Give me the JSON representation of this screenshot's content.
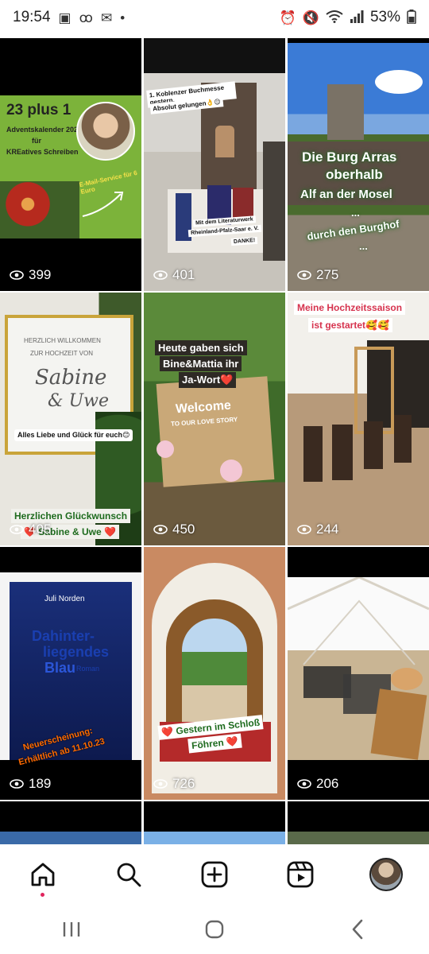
{
  "status_bar": {
    "time": "19:54",
    "battery": "53%",
    "dot": "•"
  },
  "posts": [
    {
      "views": "399",
      "texts": {
        "title": "23 plus 1",
        "sub1": "Adventskalender 2024",
        "sub2": "für",
        "sub3": "KREatives Schreiben",
        "email": "E-Mail-Service für 6 Euro"
      }
    },
    {
      "views": "401",
      "texts": {
        "caption1": "1. Koblenzer Buchmesse gestern.",
        "caption2": "Absolut gelungen👌😉",
        "caption3": "Mit dem Literaturwerk",
        "caption4": "Rheinland-Pfalz-Saar e. V.",
        "caption5": "DANKE!"
      }
    },
    {
      "views": "275",
      "texts": {
        "line1": "Die Burg Arras",
        "line2": "oberhalb",
        "line3": "Alf an der Mosel",
        "line4": "...",
        "line5": "durch den Burghof",
        "line6": "..."
      }
    },
    {
      "views": "405",
      "texts": {
        "card1": "HERZLICH WILLKOMMEN",
        "card2": "ZUR HOCHZEIT VON",
        "card3": "Sabine",
        "card4": "& Uwe",
        "wish": "Alles Liebe und Glück für euch😊",
        "congrats": "Herzlichen Glückwunsch",
        "names": "❤️ Sabine & Uwe ❤️"
      }
    },
    {
      "views": "450",
      "texts": {
        "line1": "Heute gaben sich",
        "line2": "Bine&Mattia ihr",
        "line3": "Ja-Wort❤️",
        "sign1": "Welcome",
        "sign2": "TO OUR LOVE STORY"
      }
    },
    {
      "views": "244",
      "texts": {
        "line1": "Meine Hochzeitssaison",
        "line2": "ist gestartet🥰🥰"
      }
    },
    {
      "views": "189",
      "texts": {
        "author": "Juli Norden",
        "title1": "Dahinter-",
        "title2": "liegendes",
        "title3": "Blau",
        "genre": "Roman",
        "release1": "Neuerscheinung:",
        "release2": "Erhältlich ab 11.10.23"
      }
    },
    {
      "views": "726",
      "texts": {
        "line1": "❤️ Gestern im Schloß",
        "line2": "Föhren ❤️"
      }
    },
    {
      "views": "206",
      "texts": {}
    }
  ],
  "nav": {
    "home": "home",
    "search": "search",
    "create": "create",
    "reels": "reels",
    "profile": "profile"
  }
}
